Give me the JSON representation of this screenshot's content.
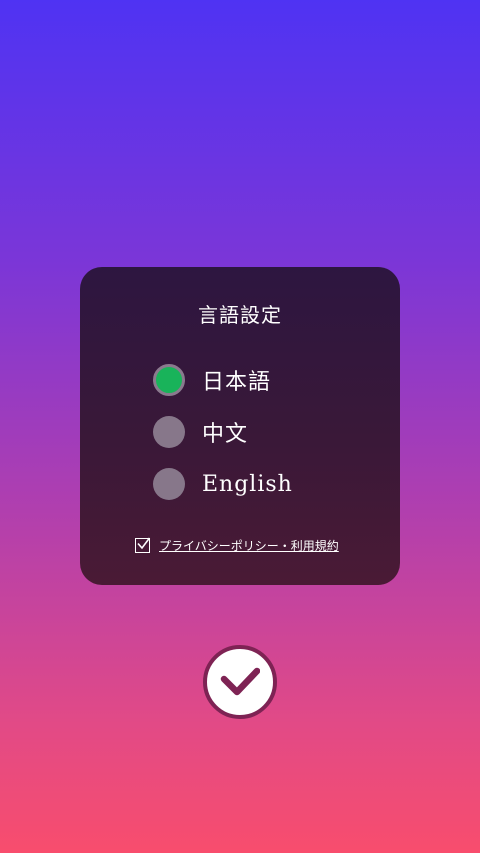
{
  "language_dialog": {
    "title": "言語設定",
    "options": [
      {
        "label": "日本語",
        "selected": true
      },
      {
        "label": "中文",
        "selected": false
      },
      {
        "label": "English",
        "selected": false
      }
    ],
    "policy": {
      "checked": true,
      "link_text": "プライバシーポリシー・利用規約"
    }
  },
  "confirm_button": {
    "icon": "check-icon"
  },
  "colors": {
    "background_top": "#4f33f3",
    "background_bottom": "#f84d6d",
    "panel": "#35173c",
    "radio_selected": "#19b35a",
    "radio_unselected": "#87778a",
    "confirm_ring": "#7e2354"
  }
}
